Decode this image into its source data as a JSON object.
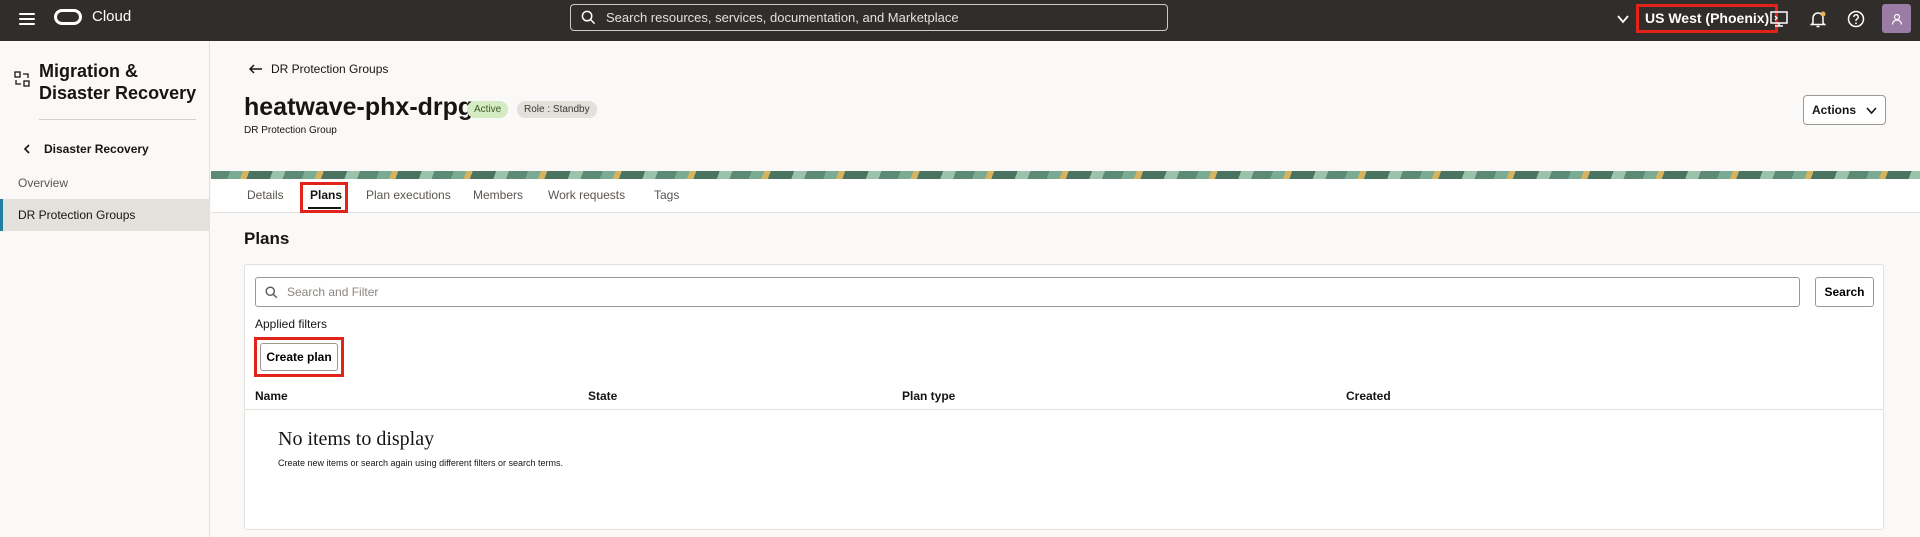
{
  "topbar": {
    "brand": "Cloud",
    "search_placeholder": "Search resources, services, documentation, and Marketplace",
    "region": "US West (Phoenix)",
    "icons": [
      "hamburger-icon",
      "search-icon",
      "chevron-down-icon",
      "cloud-shell-icon",
      "bell-icon",
      "help-icon",
      "user-icon"
    ],
    "avatar_color": "#9b7ca5"
  },
  "sidebar": {
    "title": "Migration & Disaster Recovery",
    "back_label": "Disaster Recovery",
    "items": [
      {
        "label": "Overview"
      },
      {
        "label": "DR Protection Groups"
      }
    ]
  },
  "header": {
    "back_label": "DR Protection Groups",
    "title": "heatwave-phx-drpg",
    "status_badge": "Active",
    "role_badge": "Role : Standby",
    "subtitle": "DR Protection Group",
    "actions_label": "Actions"
  },
  "tabs": [
    {
      "label": "Details"
    },
    {
      "label": "Plans"
    },
    {
      "label": "Plan executions"
    },
    {
      "label": "Members"
    },
    {
      "label": "Work requests"
    },
    {
      "label": "Tags"
    }
  ],
  "plans": {
    "section_title": "Plans",
    "filter_placeholder": "Search and Filter",
    "search_label": "Search",
    "applied_filters": "Applied filters",
    "create_label": "Create plan",
    "columns": [
      "Name",
      "State",
      "Plan type",
      "Created"
    ],
    "empty_title": "No items to display",
    "empty_sub": "Create new items or search again using different filters or search terms."
  },
  "colors": {
    "topbar": "#312d2a",
    "highlight": "#e2231a",
    "active_badge": "#d4ebc4",
    "accent": "#227e9e"
  }
}
